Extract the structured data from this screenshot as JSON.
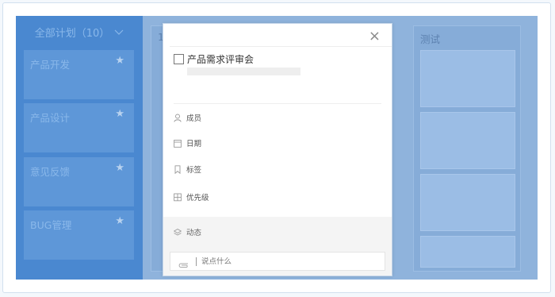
{
  "sidebar": {
    "header": "全部计划（10）",
    "items": [
      {
        "label": "产品开发",
        "starred": true
      },
      {
        "label": "产品设计",
        "starred": true
      },
      {
        "label": "意见反馈",
        "starred": true
      },
      {
        "label": "BUG管理",
        "starred": true
      }
    ]
  },
  "board": {
    "columns": [
      {
        "title": "1"
      },
      {
        "title": "测试"
      }
    ]
  },
  "modal": {
    "close_symbol": "×",
    "task_title": "产品需求评审会",
    "properties": {
      "members": "成员",
      "date": "日期",
      "tags": "标签",
      "priority": "优先级"
    },
    "activity_label": "动态",
    "comment_placeholder": "说点什么"
  },
  "colors": {
    "sidebar_bg": "#4a88d0",
    "overlay_bg": "#8fb3dc",
    "modal_bg": "#ffffff"
  },
  "icons": [
    "chevron-down-icon",
    "star-icon",
    "close-icon",
    "user-icon",
    "calendar-icon",
    "tag-icon",
    "grid-icon",
    "layers-icon",
    "paperclip-icon"
  ]
}
